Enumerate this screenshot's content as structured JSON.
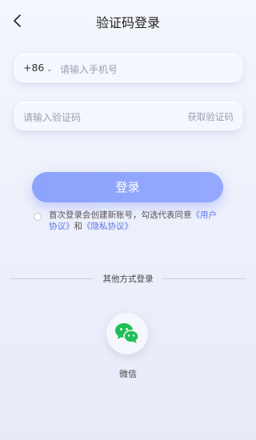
{
  "header": {
    "title": "验证码登录"
  },
  "phone": {
    "country_code": "+86",
    "placeholder": "请输入手机号"
  },
  "code": {
    "placeholder": "请输入验证码",
    "get_code": "获取验证码"
  },
  "login_label": "登录",
  "agreement": {
    "prefix": "首次登录会创建新账号，勾选代表同意",
    "user_agreement": "《用户协议》",
    "and": "和",
    "privacy_policy": "《隐私协议》"
  },
  "other_login": {
    "divider_text": "其他方式登录",
    "wechat_label": "微信"
  },
  "colors": {
    "accent": "#8ea3fb",
    "link": "#5b76e8",
    "wechat": "#1fbf57"
  }
}
